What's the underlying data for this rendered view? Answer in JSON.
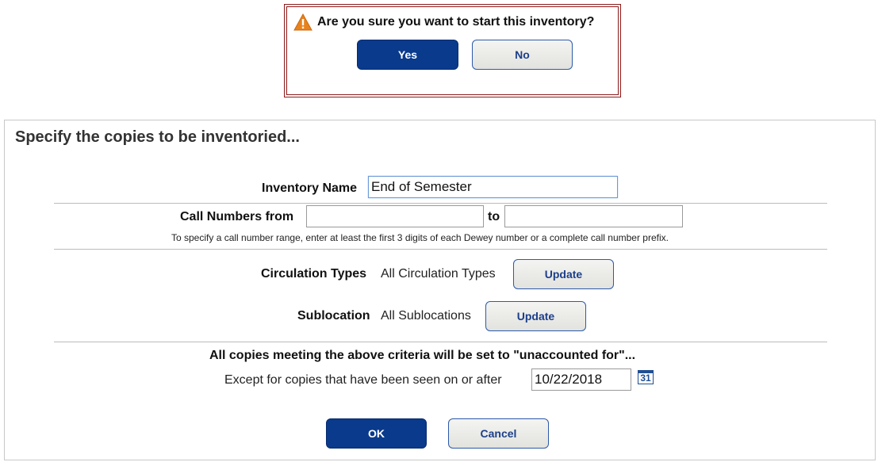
{
  "confirm_dialog": {
    "message": "Are you sure you want to start this inventory?",
    "yes_label": "Yes",
    "no_label": "No",
    "warning_icon": "warning-triangle-icon"
  },
  "form": {
    "title": "Specify the copies to be inventoried...",
    "inventory_name": {
      "label": "Inventory Name",
      "value": "End of Semester"
    },
    "call_numbers": {
      "label": "Call Numbers from",
      "from_value": "",
      "to_label": "to",
      "to_value": "",
      "hint": "To specify a call number range, enter at least the first 3 digits of each Dewey number or a complete call number prefix."
    },
    "circulation_types": {
      "label": "Circulation Types",
      "value": "All Circulation Types",
      "update_label": "Update"
    },
    "sublocation": {
      "label": "Sublocation",
      "value": "All Sublocations",
      "update_label": "Update"
    },
    "unaccounted_notice": "All copies meeting the above criteria will be set to \"unaccounted for\"...",
    "except": {
      "label": "Except for copies that have been seen on or after",
      "date": "10/22/2018",
      "calendar_icon": "calendar-icon",
      "calendar_text": "31"
    },
    "ok_label": "OK",
    "cancel_label": "Cancel"
  },
  "colors": {
    "primary_button": "#0a3a8c",
    "secondary_button_text": "#1c3f8a",
    "dialog_border": "#8b1a1a",
    "warning": "#e8821e"
  }
}
